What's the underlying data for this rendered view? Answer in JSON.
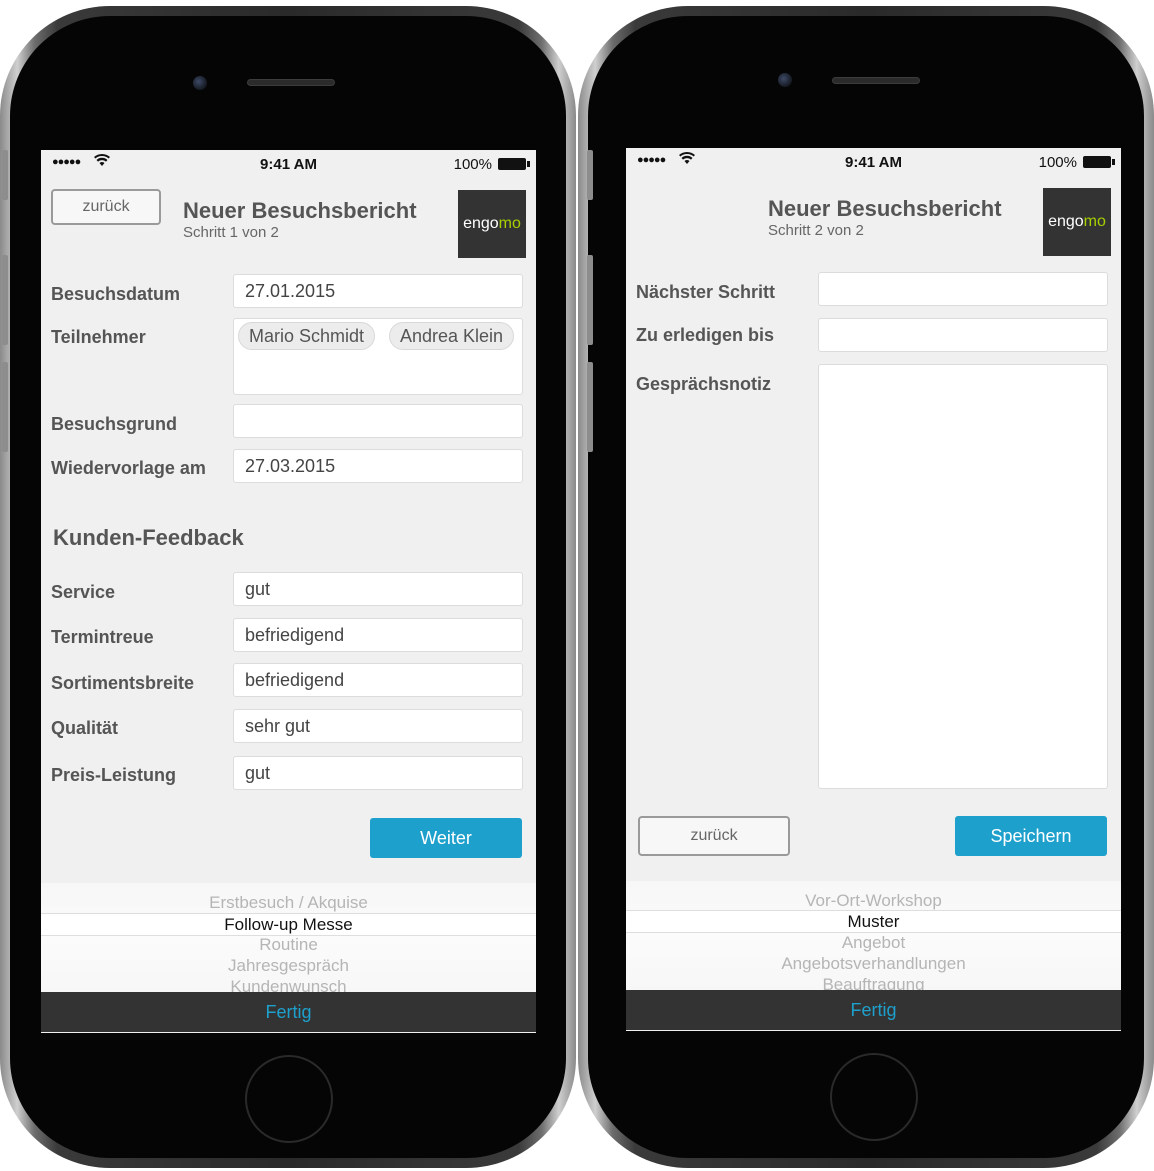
{
  "brand": {
    "logo_prefix": "engo",
    "logo_accent": "mo",
    "accent_color": "#a6d000",
    "primary_color": "#1ea0cc",
    "dark_color": "#333333"
  },
  "statusbar": {
    "signal": "●●●●●",
    "wifi_icon": "wifi-icon",
    "time": "9:41 AM",
    "battery": "100%"
  },
  "screen1": {
    "back_label": "zurück",
    "title": "Neuer Besuchsbericht",
    "step": "Schritt 1 von 2",
    "fields": {
      "visit_date_label": "Besuchsdatum",
      "visit_date_value": "27.01.2015",
      "participants_label": "Teilnehmer",
      "participants": [
        "Mario Schmidt",
        "Andrea Klein"
      ],
      "visit_reason_label": "Besuchsgrund",
      "visit_reason_value": "",
      "followup_label": "Wiedervorlage am",
      "followup_value": "27.03.2015"
    },
    "feedback": {
      "section_title": "Kunden-Feedback",
      "items": [
        {
          "label": "Service",
          "value": "gut"
        },
        {
          "label": "Termintreue",
          "value": "befriedigend"
        },
        {
          "label": "Sortimentsbreite",
          "value": "befriedigend"
        },
        {
          "label": "Qualität",
          "value": "sehr gut"
        },
        {
          "label": "Preis-Leistung",
          "value": "gut"
        }
      ]
    },
    "next_label": "Weiter",
    "picker": {
      "options": [
        "Erstbesuch / Akquise",
        "Follow-up Messe",
        "Routine",
        "Jahresgespräch",
        "Kundenwunsch"
      ],
      "selected": "Follow-up Messe",
      "done_label": "Fertig"
    }
  },
  "screen2": {
    "title": "Neuer Besuchsbericht",
    "step": "Schritt 2 von 2",
    "fields": {
      "next_step_label": "Nächster Schritt",
      "next_step_value": "",
      "due_label": "Zu erledigen bis",
      "due_value": "",
      "note_label": "Gesprächsnotiz",
      "note_value": ""
    },
    "back_label": "zurück",
    "save_label": "Speichern",
    "picker": {
      "options": [
        "Vor-Ort-Workshop",
        "Muster",
        "Angebot",
        "Angebotsverhandlungen",
        "Beauftragung"
      ],
      "selected": "Muster",
      "done_label": "Fertig"
    }
  }
}
